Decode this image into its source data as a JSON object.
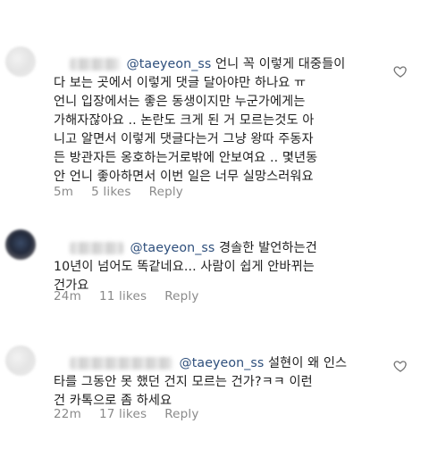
{
  "icons": {
    "like": "heart-outline-icon"
  },
  "colors": {
    "mention": "#2e4f7c",
    "meta": "#8a8a8a",
    "text": "#1f1f1f"
  },
  "comments": [
    {
      "mention": "@taeyeon_ss",
      "first_line_text": " 언니 꼭 이렇게 대중들이",
      "rest_text": "다 보는 곳에서 이렇게 댓글 달아야만 하나요 ㅠ\n언니 입장에서는 좋은 동생이지만 누군가에게는\n가해자잖아요 .. 논란도 크게 된 거 모르는것도 아\n니고 알면서 이렇게 댓글다는거 그냥 왕따 주동자\n든 방관자든 옹호하는거로밖에 안보여요 .. 몇년동\n안 언니 좋아하면서 이번 일은 너무 실망스러워요",
      "time": "5m",
      "likes": "5 likes",
      "reply": "Reply"
    },
    {
      "mention": "@taeyeon_ss",
      "first_line_text": " 경솔한 발언하는건",
      "rest_text": "10년이 넘어도 똑같네요... 사람이 쉽게 안바뀌는\n건가요",
      "time": "24m",
      "likes": "11 likes",
      "reply": "Reply"
    },
    {
      "mention": "@taeyeon_ss",
      "first_line_text": " 설현이 왜 인스",
      "rest_text": "타를 그동안 못 했던 건지 모르는 건가?ㅋㅋ 이런\n건 카톡으로 좀 하세요",
      "time": "22m",
      "likes": "17 likes",
      "reply": "Reply"
    }
  ]
}
